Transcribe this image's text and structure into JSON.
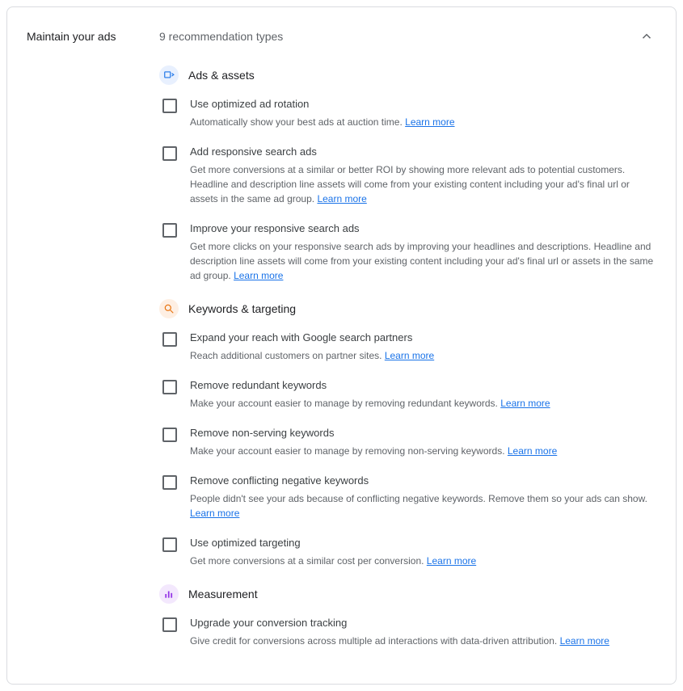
{
  "header": {
    "title": "Maintain your ads",
    "subtitle": "9 recommendation types"
  },
  "learn_more_label": "Learn more",
  "sections": [
    {
      "id": "ads-assets",
      "title": "Ads & assets",
      "icon_color": "blue",
      "items": [
        {
          "id": "optimized-ad-rotation",
          "title": "Use optimized ad rotation",
          "desc": "Automatically show your best ads at auction time."
        },
        {
          "id": "add-responsive-search-ads",
          "title": "Add responsive search ads",
          "desc": "Get more conversions at a similar or better ROI by showing more relevant ads to potential customers. Headline and description line assets will come from your existing content including your ad's final url or assets in the same ad group."
        },
        {
          "id": "improve-responsive-search-ads",
          "title": "Improve your responsive search ads",
          "desc": "Get more clicks on your responsive search ads by improving your headlines and descriptions. Headline and description line assets will come from your existing content including your ad's final url or assets in the same ad group."
        }
      ]
    },
    {
      "id": "keywords-targeting",
      "title": "Keywords & targeting",
      "icon_color": "orange",
      "items": [
        {
          "id": "expand-search-partners",
          "title": "Expand your reach with Google search partners",
          "desc": "Reach additional customers on partner sites."
        },
        {
          "id": "remove-redundant-keywords",
          "title": "Remove redundant keywords",
          "desc": "Make your account easier to manage by removing redundant keywords."
        },
        {
          "id": "remove-non-serving-keywords",
          "title": "Remove non-serving keywords",
          "desc": "Make your account easier to manage by removing non-serving keywords."
        },
        {
          "id": "remove-conflicting-negative",
          "title": "Remove conflicting negative keywords",
          "desc": "People didn't see your ads because of conflicting negative keywords. Remove them so your ads can show."
        },
        {
          "id": "optimized-targeting",
          "title": "Use optimized targeting",
          "desc": "Get more conversions at a similar cost per conversion."
        }
      ]
    },
    {
      "id": "measurement",
      "title": "Measurement",
      "icon_color": "purple",
      "items": [
        {
          "id": "upgrade-conversion-tracking",
          "title": "Upgrade your conversion tracking",
          "desc": "Give credit for conversions across multiple ad interactions with data-driven attribution."
        }
      ]
    }
  ]
}
